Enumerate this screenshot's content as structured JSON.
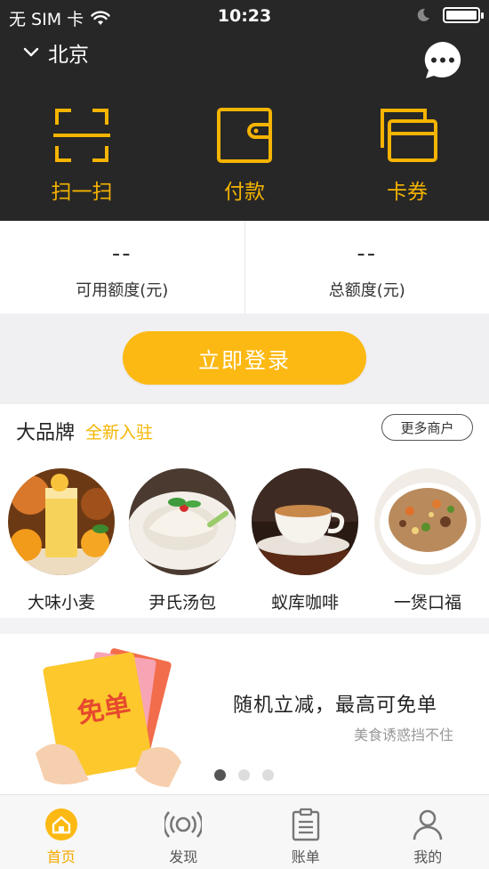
{
  "status_bar": {
    "carrier": "无 SIM 卡",
    "time": "10:23"
  },
  "header": {
    "city": "北京",
    "actions": [
      {
        "label": "扫一扫",
        "icon": "scan-icon"
      },
      {
        "label": "付款",
        "icon": "wallet-icon"
      },
      {
        "label": "卡券",
        "icon": "cards-icon"
      }
    ]
  },
  "credit": {
    "available_value": "--",
    "available_label": "可用额度(元)",
    "total_value": "--",
    "total_label": "总额度(元)"
  },
  "login": {
    "label": "立即登录"
  },
  "brands": {
    "title": "大品牌",
    "subtitle": "全新入驻",
    "more_label": "更多商户",
    "items": [
      {
        "name": "大味小麦",
        "icon": "orange-juice-image"
      },
      {
        "name": "尹氏汤包",
        "icon": "soup-dumpling-image"
      },
      {
        "name": "蚁库咖啡",
        "icon": "coffee-cup-image"
      },
      {
        "name": "一煲口福",
        "icon": "fried-rice-image"
      }
    ]
  },
  "banner": {
    "title": "随机立减，最高可免单",
    "subtitle": "美食诱惑挡不住",
    "coupon_text": "免单",
    "page_count": 3,
    "active_page": 1
  },
  "tabs": [
    {
      "label": "首页",
      "icon": "home-icon",
      "active": true
    },
    {
      "label": "发现",
      "icon": "radar-icon",
      "active": false
    },
    {
      "label": "账单",
      "icon": "bill-icon",
      "active": false
    },
    {
      "label": "我的",
      "icon": "person-icon",
      "active": false
    }
  ],
  "colors": {
    "accent": "#fdb913",
    "header_bg": "#272727",
    "icon_yellow": "#f5b400"
  }
}
